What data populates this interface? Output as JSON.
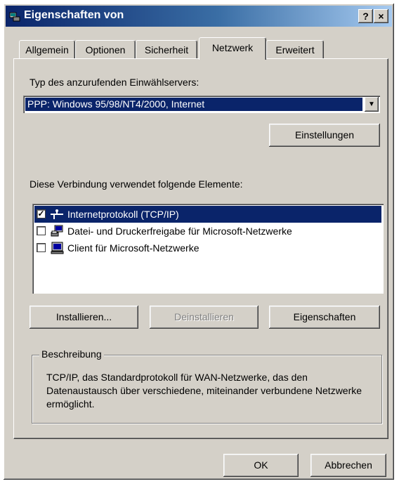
{
  "window": {
    "title": "Eigenschaften von",
    "help_label": "?",
    "close_label": "×"
  },
  "tabs": [
    {
      "label": "Allgemein"
    },
    {
      "label": "Optionen"
    },
    {
      "label": "Sicherheit"
    },
    {
      "label": "Netzwerk"
    },
    {
      "label": "Erweitert"
    }
  ],
  "server": {
    "label": "Typ des anzurufenden Einwählservers:",
    "selected": "PPP: Windows 95/98/NT4/2000, Internet",
    "settings_button": "Einstellungen"
  },
  "components": {
    "label": "Diese Verbindung verwendet folgende Elemente:",
    "items": [
      {
        "label": "Internetprotokoll (TCP/IP)",
        "checked": true,
        "icon": "network-protocol-icon"
      },
      {
        "label": "Datei- und Druckerfreigabe für Microsoft-Netzwerke",
        "checked": false,
        "icon": "file-printer-sharing-icon"
      },
      {
        "label": "Client für Microsoft-Netzwerke",
        "checked": false,
        "icon": "network-client-icon"
      }
    ],
    "install_button": "Installieren...",
    "uninstall_button": "Deinstallieren",
    "properties_button": "Eigenschaften"
  },
  "description": {
    "title": "Beschreibung",
    "text": "TCP/IP, das Standardprotokoll für WAN-Netzwerke, das den Datenaustausch über verschiedene, miteinander verbundene Netzwerke ermöglicht."
  },
  "footer": {
    "ok": "OK",
    "cancel": "Abbrechen"
  },
  "colors": {
    "face": "#d4d0c8",
    "selection": "#0a246a",
    "title_start": "#0a246a",
    "title_end": "#a6caf0"
  }
}
